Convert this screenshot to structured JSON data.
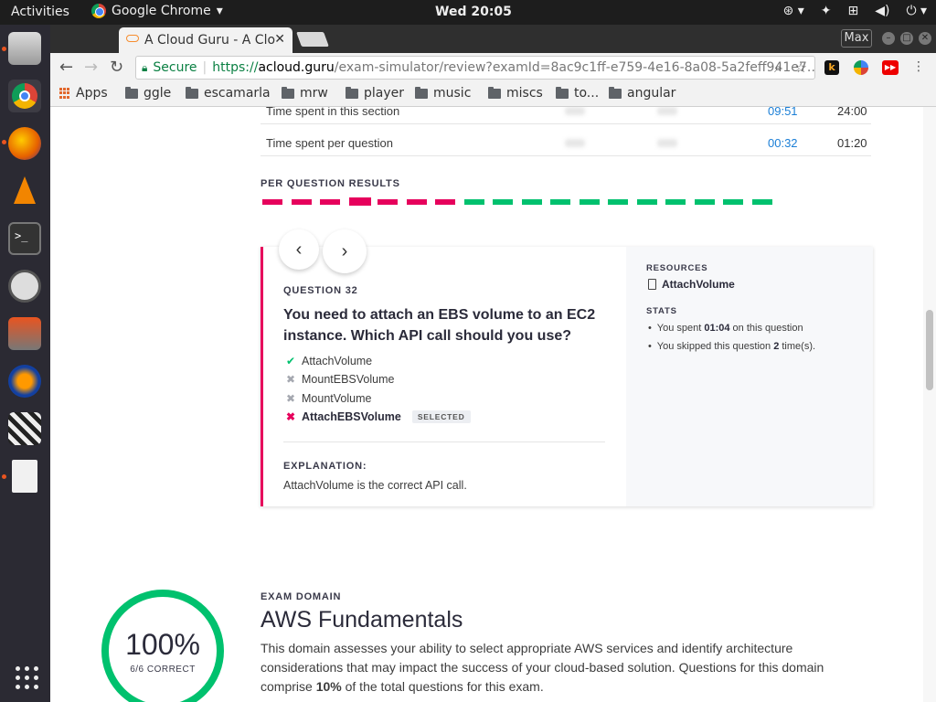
{
  "os": {
    "activities": "Activities",
    "app_name": "Google Chrome",
    "app_menu_caret": "▾",
    "clock": "Wed 20:05",
    "tray": [
      "accessibility-icon",
      "dropbox-icon",
      "network-icon",
      "volume-icon",
      "power-icon"
    ]
  },
  "dock": {
    "items": [
      "files",
      "chrome",
      "firefox",
      "vlc",
      "terminal",
      "software-updater",
      "installer",
      "audacity",
      "clapper",
      "document",
      "show-applications"
    ]
  },
  "browser": {
    "tab_title": "A Cloud Guru - A Clo",
    "tab_close": "✕",
    "max_label": "Max",
    "secure_label": "Secure",
    "url_scheme": "https://",
    "url_host": "acloud.guru",
    "url_path": "/exam-simulator/review?examId=8ac9c1ff-e759-4e16-8a08-5a2feff941e7…",
    "bookmarks": [
      "Apps",
      "ggle",
      "escamarla",
      "mrw",
      "player",
      "music",
      "miscs",
      "to...",
      "angular"
    ]
  },
  "stats_rows": [
    {
      "label": "Time spent in this section",
      "value_a": "09:51",
      "value_b": "24:00"
    },
    {
      "label": "Time spent per question",
      "value_a": "00:32",
      "value_b": "01:20"
    }
  ],
  "per_question": {
    "title": "PER QUESTION RESULTS",
    "results": [
      "incorrect",
      "incorrect",
      "incorrect",
      "incorrect",
      "incorrect",
      "incorrect",
      "incorrect",
      "correct",
      "correct",
      "correct",
      "correct",
      "correct",
      "correct",
      "correct",
      "correct",
      "correct",
      "correct",
      "correct"
    ],
    "current_index": 3,
    "colors": {
      "incorrect": "#e6005c",
      "correct": "#00c16e"
    }
  },
  "question": {
    "prev_glyph": "‹",
    "next_glyph": "›",
    "number_label": "QUESTION 32",
    "text": "You need to attach an EBS volume to an EC2 instance. Which API call should you use?",
    "answers": [
      {
        "text": "AttachVolume",
        "state": "correct",
        "glyph": "✔"
      },
      {
        "text": "MountEBSVolume",
        "state": "neutral",
        "glyph": "✖"
      },
      {
        "text": "MountVolume",
        "state": "neutral",
        "glyph": "✖"
      },
      {
        "text": "AttachEBSVolume",
        "state": "wrong",
        "glyph": "✖",
        "badge": "SELECTED"
      }
    ],
    "explanation_title": "EXPLANATION:",
    "explanation": "AttachVolume is the correct API call.",
    "resources_title": "RESOURCES",
    "resource": "AttachVolume",
    "stats_title": "STATS",
    "stat_spent_pre": "You spent ",
    "stat_spent_val": "01:04",
    "stat_spent_post": " on this question",
    "stat_skip_pre": "You skipped this question ",
    "stat_skip_val": "2",
    "stat_skip_post": " time(s)."
  },
  "domain": {
    "label": "EXAM DOMAIN",
    "title": "AWS Fundamentals",
    "desc_pre": "This domain assesses your ability to select appropriate AWS services and identify architecture considerations that may impact the success of your cloud-based solution. Questions for this domain comprise ",
    "desc_bold": "10%",
    "desc_post": " of the total questions for this exam.",
    "score_pct": "100%",
    "score_sub": "6/6 CORRECT"
  }
}
